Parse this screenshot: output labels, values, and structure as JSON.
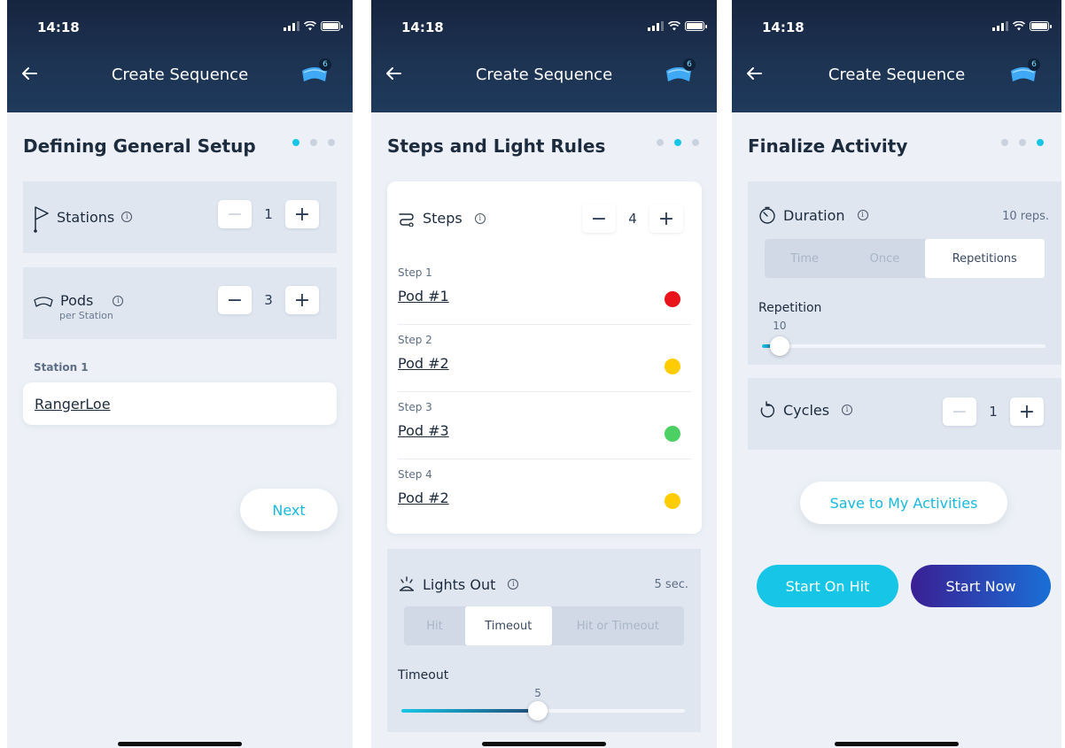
{
  "status_bar": {
    "time": "14:18"
  },
  "header": {
    "title": "Create Sequence",
    "pod_count": "6"
  },
  "screen1": {
    "heading": "Defining General Setup",
    "stations": {
      "label": "Stations",
      "value": "1"
    },
    "pods": {
      "label": "Pods",
      "sublabel": "per Station",
      "value": "3"
    },
    "station_label": "Station 1",
    "station_name": "RangerLoe",
    "next_label": "Next"
  },
  "screen2": {
    "heading": "Steps and Light Rules",
    "steps": {
      "label": "Steps",
      "value": "4",
      "items": [
        {
          "num": "Step 1",
          "pod": "Pod #1",
          "color": "#e8131b"
        },
        {
          "num": "Step 2",
          "pod": "Pod #2",
          "color": "#ffcc00"
        },
        {
          "num": "Step 3",
          "pod": "Pod #3",
          "color": "#4cd063"
        },
        {
          "num": "Step 4",
          "pod": "Pod #2",
          "color": "#ffcc00"
        }
      ]
    },
    "lights_out": {
      "label": "Lights Out",
      "summary": "5 sec.",
      "options": [
        "Hit",
        "Timeout",
        "Hit or Timeout"
      ],
      "selected": "Timeout",
      "timeout_label": "Timeout",
      "timeout_value": "5",
      "timeout_fraction": 0.48
    }
  },
  "screen3": {
    "heading": "Finalize Activity",
    "duration": {
      "label": "Duration",
      "summary": "10 reps.",
      "options": [
        "Time",
        "Once",
        "Repetitions"
      ],
      "selected": "Repetitions",
      "repetition_label": "Repetition",
      "repetition_value": "10",
      "repetition_fraction": 0.03
    },
    "cycles": {
      "label": "Cycles",
      "value": "1"
    },
    "save_label": "Save to My Activities",
    "start_on_hit_label": "Start On Hit",
    "start_now_label": "Start Now"
  },
  "colors": {
    "accent": "#17c6e6",
    "header_dark": "#16253f",
    "start_now_from": "#3a1f94",
    "start_now_to": "#1a6fd6"
  }
}
